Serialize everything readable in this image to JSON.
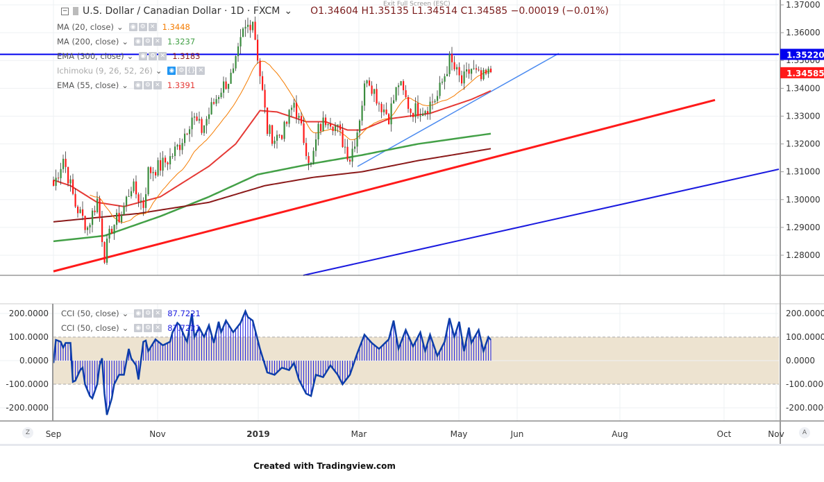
{
  "header": {
    "symbol": "U.S. Dollar / Canadian Dollar · 1D · FXCM",
    "ohlc": "O1.34604  H1.35135  L1.34514  C1.34585  −0.00019 (−0.01%)",
    "exit_fullscreen": "Exit Full Screen (ESC)"
  },
  "indicators": [
    {
      "label": "MA (20, close)",
      "value": "1.3448",
      "color": "#f57c00"
    },
    {
      "label": "MA (200, close)",
      "value": "1.3237",
      "color": "#43a047"
    },
    {
      "label": "EMA (300, close)",
      "value": "1.3183",
      "color": "#8b1a1a"
    },
    {
      "label": "Ichimoku (9, 26, 52, 26)",
      "value": "",
      "color": "#999999"
    },
    {
      "label": "EMA (55, close)",
      "value": "1.3391",
      "color": "#e53935"
    }
  ],
  "cci_legend": [
    {
      "label": "CCI (50, close)",
      "value": "87.7221"
    },
    {
      "label": "CCI (50, close)",
      "value": "87.7221"
    }
  ],
  "price_axis": {
    "ticks": [
      "1.37000",
      "1.36000",
      "1.35000",
      "1.34000",
      "1.33000",
      "1.32000",
      "1.31000",
      "1.30000",
      "1.29000",
      "1.28000"
    ],
    "line_label": "1.35220",
    "last_label": "1.34585"
  },
  "cci_axis": {
    "ticks": [
      "200.0000",
      "100.0000",
      "0.0000",
      "-100.0000",
      "-200.0000"
    ]
  },
  "time_axis": {
    "ticks": [
      "Sep",
      "Nov",
      "2019",
      "Mar",
      "May",
      "Jun",
      "Aug",
      "Oct",
      "Nov"
    ]
  },
  "buttons": {
    "zoom": "Z",
    "auto": "A"
  },
  "footer": "Created with Tradingview.com",
  "colors": {
    "up": "#3a8c3e",
    "down": "#ff1a1a",
    "hline": "#0000ee",
    "cci": "#0d3ea8",
    "band": "#ede3d0"
  },
  "chart_data": {
    "type": "candlestick",
    "title": "USD/CAD 1D",
    "ylim": [
      1.2725,
      1.3725
    ],
    "cci_ylim": [
      -250,
      250
    ],
    "close_path": [
      [
        0,
        1.305
      ],
      [
        4,
        1.315
      ],
      [
        7,
        1.305
      ],
      [
        9,
        1.298
      ],
      [
        14,
        1.29
      ],
      [
        18,
        1.3
      ],
      [
        21,
        1.28
      ],
      [
        24,
        1.29
      ],
      [
        28,
        1.295
      ],
      [
        32,
        1.305
      ],
      [
        37,
        1.298
      ],
      [
        39,
        1.31
      ],
      [
        44,
        1.312
      ],
      [
        48,
        1.315
      ],
      [
        52,
        1.32
      ],
      [
        57,
        1.33
      ],
      [
        61,
        1.325
      ],
      [
        65,
        1.333
      ],
      [
        69,
        1.34
      ],
      [
        74,
        1.345
      ],
      [
        78,
        1.36
      ],
      [
        82,
        1.365
      ],
      [
        85,
        1.345
      ],
      [
        88,
        1.325
      ],
      [
        91,
        1.322
      ],
      [
        95,
        1.325
      ],
      [
        99,
        1.335
      ],
      [
        102,
        1.325
      ],
      [
        106,
        1.312
      ],
      [
        109,
        1.325
      ],
      [
        113,
        1.33
      ],
      [
        117,
        1.325
      ],
      [
        122,
        1.315
      ],
      [
        125,
        1.325
      ],
      [
        129,
        1.345
      ],
      [
        134,
        1.335
      ],
      [
        138,
        1.33
      ],
      [
        142,
        1.342
      ],
      [
        147,
        1.332
      ],
      [
        153,
        1.333
      ],
      [
        158,
        1.337
      ],
      [
        163,
        1.35
      ],
      [
        168,
        1.342
      ],
      [
        172,
        1.347
      ],
      [
        176,
        1.343
      ],
      [
        180,
        1.3458
      ]
    ],
    "ma200": [
      [
        0,
        1.285
      ],
      [
        21,
        1.287
      ],
      [
        44,
        1.294
      ],
      [
        64,
        1.301
      ],
      [
        84,
        1.309
      ],
      [
        107,
        1.313
      ],
      [
        127,
        1.316
      ],
      [
        150,
        1.32
      ],
      [
        180,
        1.3237
      ]
    ],
    "ema300": [
      [
        0,
        1.292
      ],
      [
        35,
        1.295
      ],
      [
        64,
        1.299
      ],
      [
        87,
        1.305
      ],
      [
        107,
        1.308
      ],
      [
        127,
        1.31
      ],
      [
        150,
        1.314
      ],
      [
        180,
        1.3183
      ]
    ],
    "ema55": [
      [
        0,
        1.307
      ],
      [
        7,
        1.305
      ],
      [
        18,
        1.299
      ],
      [
        29,
        1.2975
      ],
      [
        44,
        1.301
      ],
      [
        64,
        1.312
      ],
      [
        75,
        1.32
      ],
      [
        85,
        1.332
      ],
      [
        92,
        1.3315
      ],
      [
        104,
        1.328
      ],
      [
        112,
        1.328
      ],
      [
        121,
        1.325
      ],
      [
        127,
        1.325
      ],
      [
        138,
        1.329
      ],
      [
        155,
        1.331
      ],
      [
        172,
        1.336
      ],
      [
        180,
        1.3391
      ]
    ],
    "hline": 1.3522,
    "trendlines": [
      {
        "name": "red-support",
        "color": "#ff1a1a",
        "from": [
          0,
          1.2742
        ]
      }
    ],
    "cci": [
      [
        0,
        -10
      ],
      [
        1,
        88
      ],
      [
        3,
        80
      ],
      [
        4,
        55
      ],
      [
        5,
        75
      ],
      [
        7,
        75
      ],
      [
        8,
        -90
      ],
      [
        9,
        -85
      ],
      [
        11,
        -40
      ],
      [
        12,
        -30
      ],
      [
        13,
        -100
      ],
      [
        15,
        -150
      ],
      [
        16,
        -160
      ],
      [
        18,
        -100
      ],
      [
        19,
        -20
      ],
      [
        20,
        10
      ],
      [
        21,
        -140
      ],
      [
        22,
        -230
      ],
      [
        24,
        -160
      ],
      [
        25,
        -100
      ],
      [
        27,
        -60
      ],
      [
        29,
        -60
      ],
      [
        31,
        50
      ],
      [
        32,
        10
      ],
      [
        34,
        -20
      ],
      [
        35,
        -80
      ],
      [
        37,
        80
      ],
      [
        38,
        85
      ],
      [
        39,
        40
      ],
      [
        42,
        90
      ],
      [
        45,
        65
      ],
      [
        48,
        80
      ],
      [
        49,
        120
      ],
      [
        51,
        160
      ],
      [
        52,
        150
      ],
      [
        54,
        100
      ],
      [
        55,
        80
      ],
      [
        57,
        200
      ],
      [
        58,
        100
      ],
      [
        60,
        140
      ],
      [
        62,
        100
      ],
      [
        64,
        150
      ],
      [
        66,
        75
      ],
      [
        68,
        165
      ],
      [
        69,
        120
      ],
      [
        71,
        170
      ],
      [
        74,
        120
      ],
      [
        77,
        160
      ],
      [
        79,
        210
      ],
      [
        80,
        185
      ],
      [
        82,
        170
      ],
      [
        85,
        50
      ],
      [
        88,
        -50
      ],
      [
        91,
        -60
      ],
      [
        94,
        -30
      ],
      [
        97,
        -40
      ],
      [
        99,
        -10
      ],
      [
        101,
        -80
      ],
      [
        104,
        -140
      ],
      [
        106,
        -150
      ],
      [
        108,
        -60
      ],
      [
        111,
        -70
      ],
      [
        114,
        -20
      ],
      [
        117,
        -60
      ],
      [
        119,
        -100
      ],
      [
        122,
        -60
      ],
      [
        125,
        30
      ],
      [
        128,
        110
      ],
      [
        131,
        75
      ],
      [
        134,
        50
      ],
      [
        138,
        90
      ],
      [
        140,
        170
      ],
      [
        142,
        50
      ],
      [
        145,
        130
      ],
      [
        148,
        60
      ],
      [
        151,
        120
      ],
      [
        153,
        40
      ],
      [
        155,
        110
      ],
      [
        158,
        20
      ],
      [
        161,
        80
      ],
      [
        163,
        180
      ],
      [
        165,
        100
      ],
      [
        167,
        165
      ],
      [
        169,
        40
      ],
      [
        171,
        140
      ],
      [
        172,
        75
      ],
      [
        175,
        130
      ],
      [
        177,
        40
      ],
      [
        179,
        100
      ],
      [
        180,
        88
      ]
    ]
  }
}
